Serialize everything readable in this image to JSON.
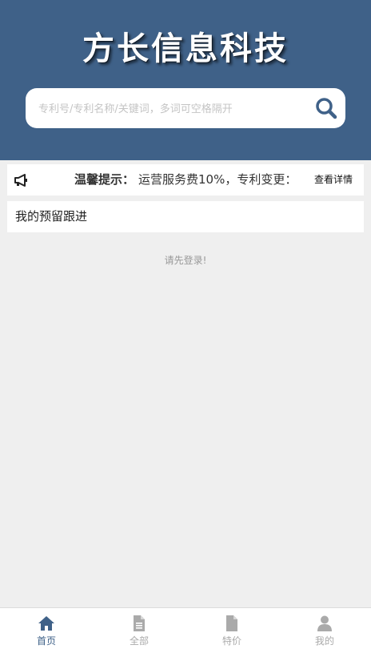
{
  "header": {
    "brand": "方长信息科技",
    "search_placeholder": "专利号/专利名称/关键词，多词可空格隔开"
  },
  "notice": {
    "label": "温馨提示：",
    "text": "运营服务费10%，专利变更：",
    "detail": "查看详情"
  },
  "followup": {
    "title": "我的预留跟进"
  },
  "login_message": "请先登录!",
  "tabbar": {
    "tabs": [
      {
        "label": "首页",
        "icon": "home-icon",
        "active": true
      },
      {
        "label": "全部",
        "icon": "document-icon",
        "active": false
      },
      {
        "label": "特价",
        "icon": "file-icon",
        "active": false
      },
      {
        "label": "我的",
        "icon": "user-icon",
        "active": false
      }
    ]
  },
  "colors": {
    "header_bg": "#3f6188",
    "active_tab": "#3f6188",
    "inactive_tab": "#aaaaaa",
    "page_bg": "#efefef"
  }
}
